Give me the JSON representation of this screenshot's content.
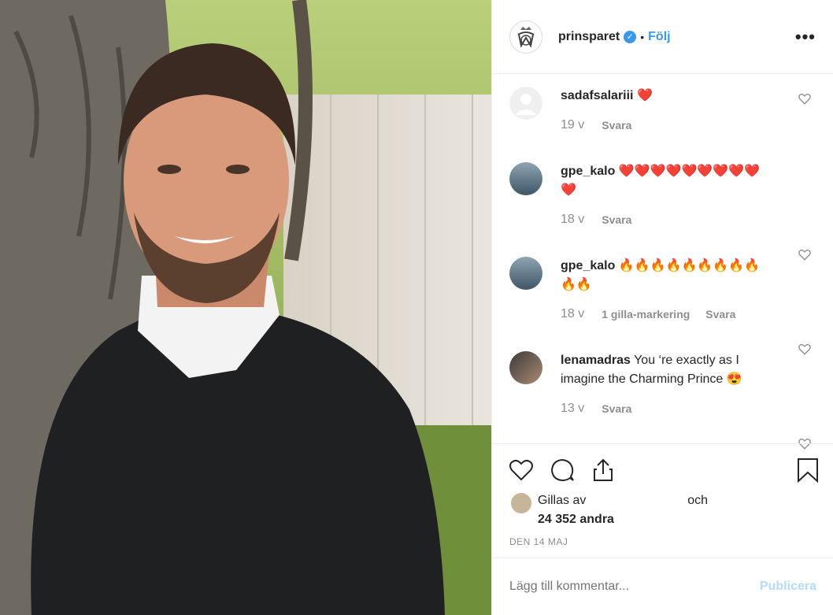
{
  "header": {
    "username": "prinsparet",
    "follow_label": "Följ",
    "more_label": "•••"
  },
  "comments": [
    {
      "username": "sadafsalariii",
      "text": "❤️",
      "time": "19 v",
      "reply": "Svara",
      "likes": ""
    },
    {
      "username": "gpe_kalo",
      "text": "❤️❤️❤️❤️❤️❤️❤️❤️❤️❤️",
      "time": "18 v",
      "reply": "Svara",
      "likes": ""
    },
    {
      "username": "gpe_kalo",
      "text": "🔥🔥🔥🔥🔥🔥🔥🔥🔥🔥🔥",
      "time": "18 v",
      "reply": "Svara",
      "likes": "1 gilla-markering"
    },
    {
      "username": "lenamadras",
      "text": "You ‘re exactly as I imagine the Charming Prince 😍",
      "time": "13 v",
      "reply": "Svara",
      "likes": ""
    }
  ],
  "likes": {
    "prefix": "Gillas av",
    "suffix": "och",
    "count": "24 352 andra"
  },
  "date": "DEN 14 MAJ",
  "add_comment": {
    "placeholder": "Lägg till kommentar...",
    "publish_label": "Publicera"
  },
  "icons": [
    "like-icon",
    "comment-icon",
    "share-icon",
    "bookmark-icon"
  ],
  "colors": {
    "link": "#3897f0",
    "muted": "#8e8e8e",
    "publish_disabled": "#b3dbff"
  }
}
